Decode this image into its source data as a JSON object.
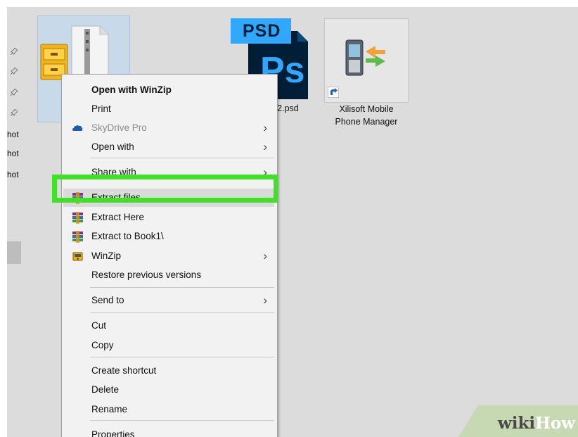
{
  "sidebar": {
    "labels": [
      "hot",
      "hot",
      "hot"
    ]
  },
  "desktop": {
    "psd_file_label": "-2.psd",
    "psd_badge": "PSD",
    "psd_app_letters": "Ps",
    "xilisoft_label_line1": "Xilisoft Mobile",
    "xilisoft_label_line2": "Phone Manager"
  },
  "context_menu": {
    "items": [
      {
        "label": "Open with WinZip",
        "bold": true
      },
      {
        "label": "Print"
      },
      {
        "label": "SkyDrive Pro",
        "disabled": true,
        "submenu": true,
        "icon": "skydrive-icon"
      },
      {
        "label": "Open with",
        "submenu": true
      },
      {
        "label": "Share with",
        "submenu": true
      },
      {
        "label": "Extract files...",
        "icon": "winrar-icon"
      },
      {
        "label": "Extract Here",
        "icon": "winrar-icon"
      },
      {
        "label": "Extract to Book1\\",
        "icon": "winrar-icon"
      },
      {
        "label": "WinZip",
        "submenu": true,
        "icon": "winzip-icon"
      },
      {
        "label": "Restore previous versions"
      },
      {
        "label": "Send to",
        "submenu": true
      },
      {
        "label": "Cut"
      },
      {
        "label": "Copy"
      },
      {
        "label": "Create shortcut"
      },
      {
        "label": "Delete"
      },
      {
        "label": "Rename"
      },
      {
        "label": "Properties"
      }
    ],
    "submenu_arrow": "›"
  },
  "highlight": {
    "color": "#3fe026",
    "target": "Extract files..."
  },
  "watermark": {
    "text_wiki": "wiki",
    "text_how": "How"
  },
  "colors": {
    "desktop_bg": "#dcdcdc",
    "menu_bg": "#f2f2f2",
    "selection": "#c8d9ea",
    "photoshop_blue": "#31a8ff",
    "photoshop_dark": "#001e36"
  }
}
